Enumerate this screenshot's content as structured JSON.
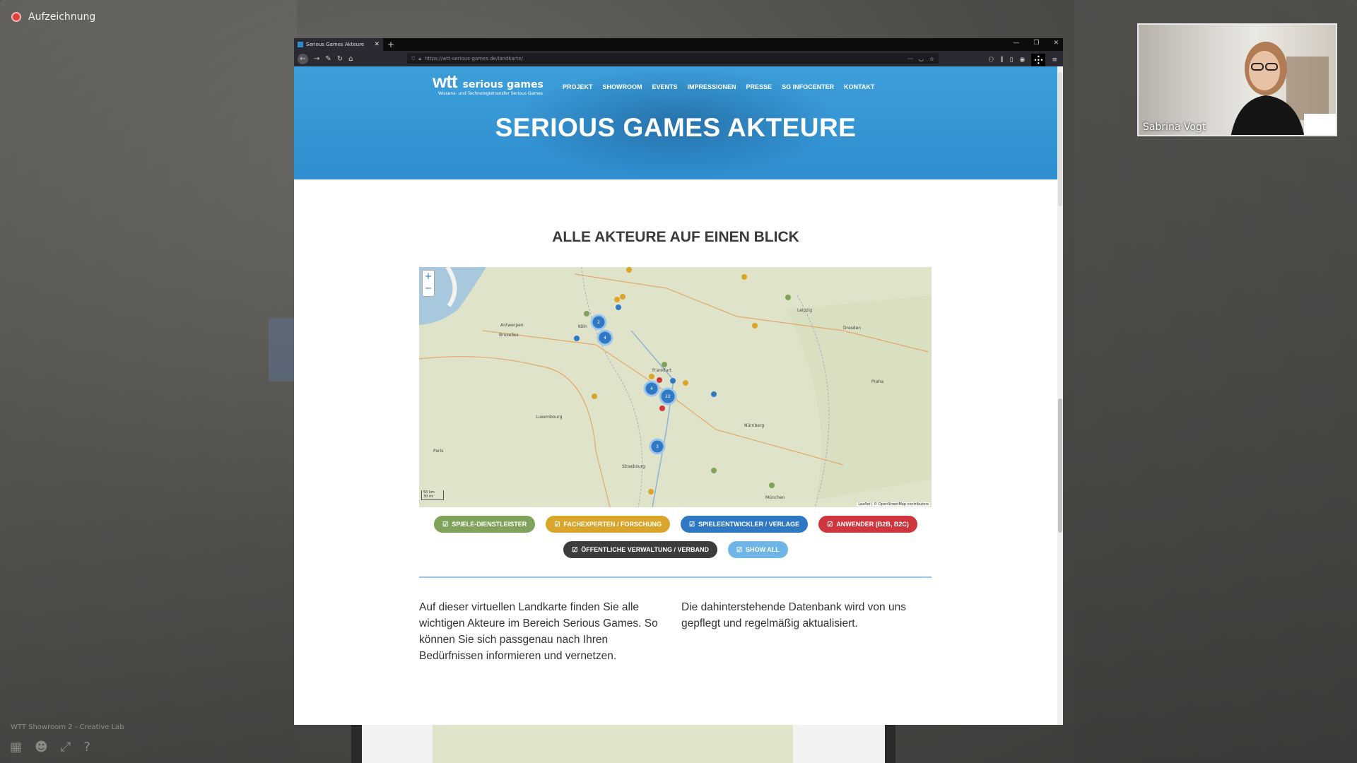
{
  "meeting": {
    "recording_label": "Aufzeichnung",
    "room_label": "WTT Showroom 2 - Creative Lab",
    "participant_name": "Sabrina Vogt",
    "bottom_icons": [
      "grid-icon",
      "people-icon",
      "fullscreen-icon",
      "help-icon"
    ],
    "accent_color": "#e0413a"
  },
  "browser": {
    "tab_title": "Serious Games Akteure",
    "url": "https://wtt-serious-games.de/landkarte/",
    "new_tab": "+"
  },
  "site": {
    "logo_main": "wtt",
    "logo_sg": "serious games",
    "logo_sub": "Wissens- und Technologietransfer Serious Games",
    "menu": [
      "PROJEKT",
      "SHOWROOM",
      "EVENTS",
      "IMPRESSIONEN",
      "PRESSE",
      "SG INFOCENTER",
      "KONTAKT"
    ],
    "hero_title": "SERIOUS GAMES AKTEURE",
    "section_title": "ALLE AKTEURE AUF EINEN BLICK",
    "hero_color": "#3494d4"
  },
  "map": {
    "attribution": "Leaflet | © OpenStreetMap contributors",
    "scale_top": "50 km",
    "scale_bottom": "30 mi",
    "cities": [
      "Leipzig",
      "Dresden",
      "Praha",
      "Paris",
      "Nürnberg",
      "München",
      "Strasbourg",
      "Luxembourg",
      "Antwerpen",
      "Köln",
      "Frankfurt",
      "Bruxelles"
    ],
    "clusters": [
      "2",
      "4",
      "4",
      "3",
      "22"
    ],
    "zoom_in": "+",
    "zoom_out": "−"
  },
  "filters": [
    {
      "label": "SPIELE-DIENSTLEISTER",
      "color": "#7fa35b"
    },
    {
      "label": "FACHEXPERTEN / FORSCHUNG",
      "color": "#d9a52a"
    },
    {
      "label": "SPIELEENTWICKLER / VERLAGE",
      "color": "#2e78c4"
    },
    {
      "label": "ANWENDER (B2B, B2C)",
      "color": "#d0343c"
    },
    {
      "label": "ÖFFENTLICHE VERWALTUNG / VERBAND",
      "color": "#3c3c3c"
    },
    {
      "label": "SHOW ALL",
      "color": "#6fb6e6"
    }
  ],
  "text_left": "Auf dieser virtuellen Landkarte finden Sie alle wichtigen Akteure im Bereich Serious Games. So können Sie sich passgenau nach Ihren Bedürfnissen informieren und vernetzen.",
  "text_right": "Die dahinterstehende Datenbank wird von uns gepflegt und regelmäßig aktualisiert."
}
